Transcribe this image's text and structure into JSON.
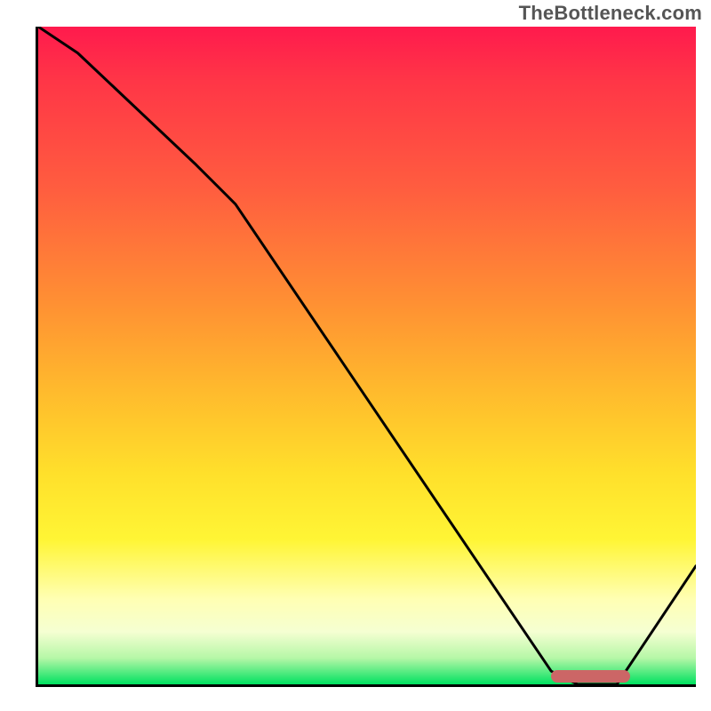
{
  "watermark": "TheBottleneck.com",
  "colors": {
    "axis": "#000000",
    "curve": "#000000",
    "marker": "#cc6666",
    "gradient_top": "#ff1a4d",
    "gradient_bottom": "#00e160"
  },
  "chart_data": {
    "type": "line",
    "x": [
      0.0,
      0.06,
      0.24,
      0.3,
      0.78,
      0.82,
      0.88,
      1.0
    ],
    "values": [
      1.0,
      0.96,
      0.79,
      0.73,
      0.02,
      0.0,
      0.0,
      0.18
    ],
    "title": "",
    "xlabel": "",
    "ylabel": "",
    "xlim": [
      0,
      1
    ],
    "ylim": [
      0,
      1
    ],
    "marker_range_x": [
      0.78,
      0.9
    ],
    "marker_y": 0.012
  }
}
